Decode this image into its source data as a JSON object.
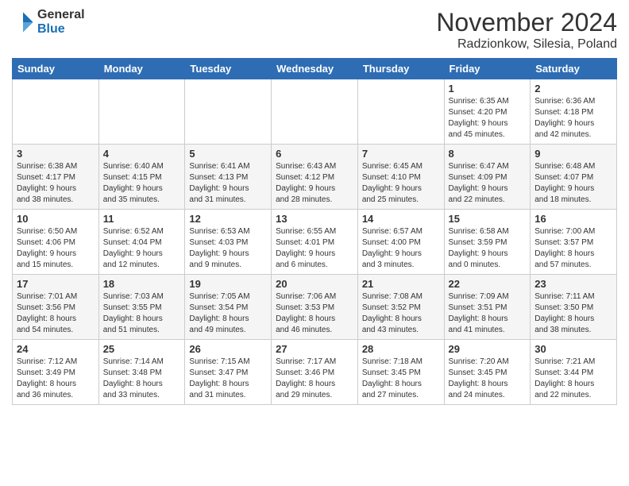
{
  "header": {
    "logo_general": "General",
    "logo_blue": "Blue",
    "month_title": "November 2024",
    "location": "Radzionkow, Silesia, Poland"
  },
  "days_of_week": [
    "Sunday",
    "Monday",
    "Tuesday",
    "Wednesday",
    "Thursday",
    "Friday",
    "Saturday"
  ],
  "weeks": [
    [
      {
        "day": "",
        "info": ""
      },
      {
        "day": "",
        "info": ""
      },
      {
        "day": "",
        "info": ""
      },
      {
        "day": "",
        "info": ""
      },
      {
        "day": "",
        "info": ""
      },
      {
        "day": "1",
        "info": "Sunrise: 6:35 AM\nSunset: 4:20 PM\nDaylight: 9 hours\nand 45 minutes."
      },
      {
        "day": "2",
        "info": "Sunrise: 6:36 AM\nSunset: 4:18 PM\nDaylight: 9 hours\nand 42 minutes."
      }
    ],
    [
      {
        "day": "3",
        "info": "Sunrise: 6:38 AM\nSunset: 4:17 PM\nDaylight: 9 hours\nand 38 minutes."
      },
      {
        "day": "4",
        "info": "Sunrise: 6:40 AM\nSunset: 4:15 PM\nDaylight: 9 hours\nand 35 minutes."
      },
      {
        "day": "5",
        "info": "Sunrise: 6:41 AM\nSunset: 4:13 PM\nDaylight: 9 hours\nand 31 minutes."
      },
      {
        "day": "6",
        "info": "Sunrise: 6:43 AM\nSunset: 4:12 PM\nDaylight: 9 hours\nand 28 minutes."
      },
      {
        "day": "7",
        "info": "Sunrise: 6:45 AM\nSunset: 4:10 PM\nDaylight: 9 hours\nand 25 minutes."
      },
      {
        "day": "8",
        "info": "Sunrise: 6:47 AM\nSunset: 4:09 PM\nDaylight: 9 hours\nand 22 minutes."
      },
      {
        "day": "9",
        "info": "Sunrise: 6:48 AM\nSunset: 4:07 PM\nDaylight: 9 hours\nand 18 minutes."
      }
    ],
    [
      {
        "day": "10",
        "info": "Sunrise: 6:50 AM\nSunset: 4:06 PM\nDaylight: 9 hours\nand 15 minutes."
      },
      {
        "day": "11",
        "info": "Sunrise: 6:52 AM\nSunset: 4:04 PM\nDaylight: 9 hours\nand 12 minutes."
      },
      {
        "day": "12",
        "info": "Sunrise: 6:53 AM\nSunset: 4:03 PM\nDaylight: 9 hours\nand 9 minutes."
      },
      {
        "day": "13",
        "info": "Sunrise: 6:55 AM\nSunset: 4:01 PM\nDaylight: 9 hours\nand 6 minutes."
      },
      {
        "day": "14",
        "info": "Sunrise: 6:57 AM\nSunset: 4:00 PM\nDaylight: 9 hours\nand 3 minutes."
      },
      {
        "day": "15",
        "info": "Sunrise: 6:58 AM\nSunset: 3:59 PM\nDaylight: 9 hours\nand 0 minutes."
      },
      {
        "day": "16",
        "info": "Sunrise: 7:00 AM\nSunset: 3:57 PM\nDaylight: 8 hours\nand 57 minutes."
      }
    ],
    [
      {
        "day": "17",
        "info": "Sunrise: 7:01 AM\nSunset: 3:56 PM\nDaylight: 8 hours\nand 54 minutes."
      },
      {
        "day": "18",
        "info": "Sunrise: 7:03 AM\nSunset: 3:55 PM\nDaylight: 8 hours\nand 51 minutes."
      },
      {
        "day": "19",
        "info": "Sunrise: 7:05 AM\nSunset: 3:54 PM\nDaylight: 8 hours\nand 49 minutes."
      },
      {
        "day": "20",
        "info": "Sunrise: 7:06 AM\nSunset: 3:53 PM\nDaylight: 8 hours\nand 46 minutes."
      },
      {
        "day": "21",
        "info": "Sunrise: 7:08 AM\nSunset: 3:52 PM\nDaylight: 8 hours\nand 43 minutes."
      },
      {
        "day": "22",
        "info": "Sunrise: 7:09 AM\nSunset: 3:51 PM\nDaylight: 8 hours\nand 41 minutes."
      },
      {
        "day": "23",
        "info": "Sunrise: 7:11 AM\nSunset: 3:50 PM\nDaylight: 8 hours\nand 38 minutes."
      }
    ],
    [
      {
        "day": "24",
        "info": "Sunrise: 7:12 AM\nSunset: 3:49 PM\nDaylight: 8 hours\nand 36 minutes."
      },
      {
        "day": "25",
        "info": "Sunrise: 7:14 AM\nSunset: 3:48 PM\nDaylight: 8 hours\nand 33 minutes."
      },
      {
        "day": "26",
        "info": "Sunrise: 7:15 AM\nSunset: 3:47 PM\nDaylight: 8 hours\nand 31 minutes."
      },
      {
        "day": "27",
        "info": "Sunrise: 7:17 AM\nSunset: 3:46 PM\nDaylight: 8 hours\nand 29 minutes."
      },
      {
        "day": "28",
        "info": "Sunrise: 7:18 AM\nSunset: 3:45 PM\nDaylight: 8 hours\nand 27 minutes."
      },
      {
        "day": "29",
        "info": "Sunrise: 7:20 AM\nSunset: 3:45 PM\nDaylight: 8 hours\nand 24 minutes."
      },
      {
        "day": "30",
        "info": "Sunrise: 7:21 AM\nSunset: 3:44 PM\nDaylight: 8 hours\nand 22 minutes."
      }
    ]
  ]
}
